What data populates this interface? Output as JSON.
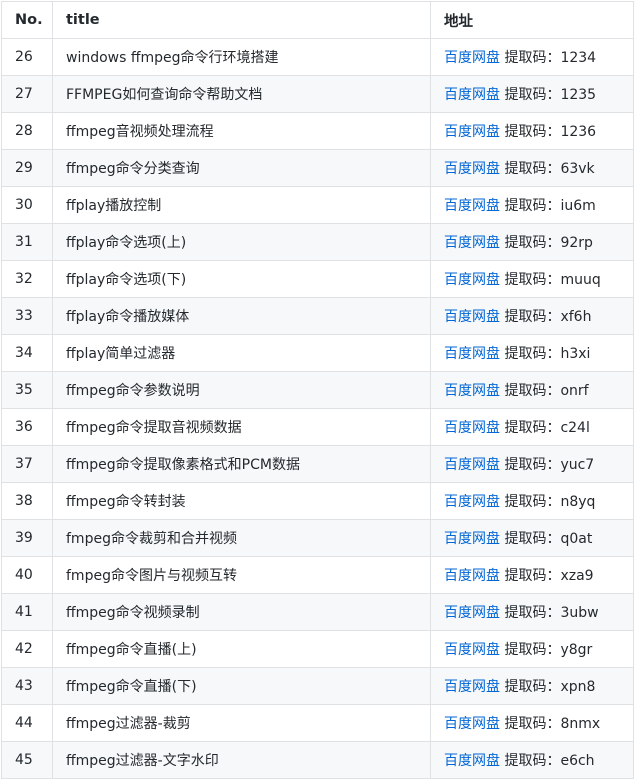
{
  "headers": {
    "no": "No.",
    "title": "title",
    "addr": "地址"
  },
  "link_label": "百度网盘",
  "code_prefix": "提取码：",
  "rows": [
    {
      "no": "26",
      "title": "windows ffmpeg命令行环境搭建",
      "code": "1234"
    },
    {
      "no": "27",
      "title": "FFMPEG如何查询命令帮助文档",
      "code": "1235"
    },
    {
      "no": "28",
      "title": "ffmpeg音视频处理流程",
      "code": "1236"
    },
    {
      "no": "29",
      "title": "ffmpeg命令分类查询",
      "code": "63vk"
    },
    {
      "no": "30",
      "title": "ffplay播放控制",
      "code": "iu6m"
    },
    {
      "no": "31",
      "title": "ffplay命令选项(上)",
      "code": "92rp"
    },
    {
      "no": "32",
      "title": "ffplay命令选项(下)",
      "code": "muuq"
    },
    {
      "no": "33",
      "title": "ffplay命令播放媒体",
      "code": "xf6h"
    },
    {
      "no": "34",
      "title": "ffplay简单过滤器",
      "code": "h3xi"
    },
    {
      "no": "35",
      "title": "ffmpeg命令参数说明",
      "code": "onrf"
    },
    {
      "no": "36",
      "title": "ffmpeg命令提取音视频数据",
      "code": "c24l"
    },
    {
      "no": "37",
      "title": "ffmpeg命令提取像素格式和PCM数据",
      "code": "yuc7"
    },
    {
      "no": "38",
      "title": "ffmpeg命令转封装",
      "code": "n8yq"
    },
    {
      "no": "39",
      "title": "fmpeg命令裁剪和合并视频",
      "code": "q0at"
    },
    {
      "no": "40",
      "title": "fmpeg命令图片与视频互转",
      "code": "xza9"
    },
    {
      "no": "41",
      "title": "ffmpeg命令视频录制",
      "code": "3ubw"
    },
    {
      "no": "42",
      "title": "ffmpeg命令直播(上)",
      "code": "y8gr"
    },
    {
      "no": "43",
      "title": "ffmpeg命令直播(下)",
      "code": "xpn8"
    },
    {
      "no": "44",
      "title": "ffmpeg过滤器-裁剪",
      "code": "8nmx"
    },
    {
      "no": "45",
      "title": "ffmpeg过滤器-文字水印",
      "code": "e6ch"
    }
  ]
}
